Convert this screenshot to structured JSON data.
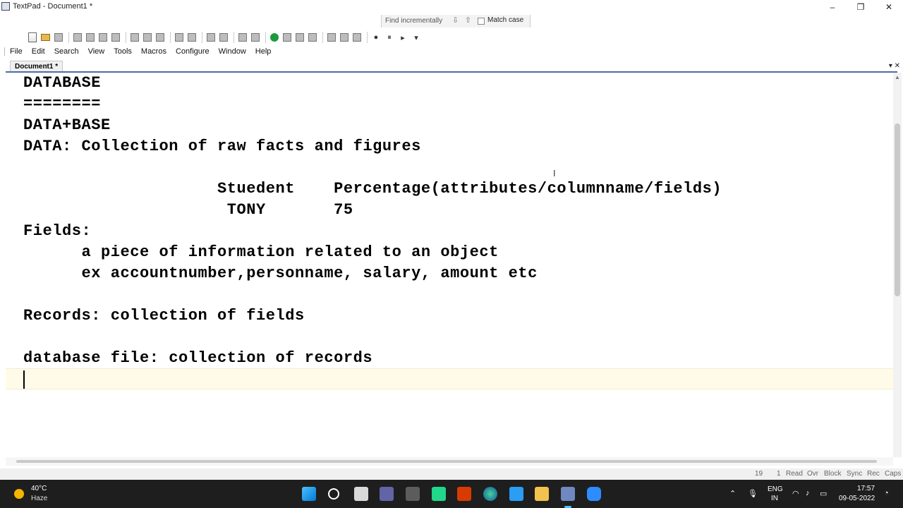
{
  "window": {
    "title": "TextPad - Document1 *",
    "minimize": "–",
    "maximize": "❐",
    "close": "✕"
  },
  "findbar": {
    "placeholder": "Find incrementally",
    "match_case_label": "Match case",
    "prev_arrow": "⇩",
    "next_arrow": "⇧"
  },
  "menu": [
    "File",
    "Edit",
    "Search",
    "View",
    "Tools",
    "Macros",
    "Configure",
    "Window",
    "Help"
  ],
  "tabs": [
    {
      "label": "Document1 *"
    }
  ],
  "tab_controls": "▾ ✕",
  "editor": {
    "lines": [
      "DATABASE",
      "========",
      "DATA+BASE",
      "DATA: Collection of raw facts and figures",
      "",
      "                    Stuedent    Percentage(attributes/columnname/fields)",
      "                     TONY       75",
      "Fields:",
      "      a piece of information related to an object",
      "      ex accountnumber,personname, salary, amount etc",
      "",
      "Records: collection of fields",
      "",
      "database file: collection of records",
      ""
    ],
    "cursor_line": 15
  },
  "status": {
    "line": "19",
    "col": "1",
    "read": "Read",
    "ovr": "Ovr",
    "block": "Block",
    "sync": "Sync",
    "rec": "Rec",
    "caps": "Caps"
  },
  "taskbar": {
    "weather_temp": "40°C",
    "weather_condition": "Haze",
    "apps": [
      "start-icon",
      "search-icon",
      "file-explorer-icon",
      "teams-icon",
      "camera-icon",
      "pycharm-icon",
      "office-icon",
      "edge-icon",
      "vscode-icon",
      "folder-icon",
      "textpad-icon",
      "zoom-icon"
    ],
    "lang_top": "ENG",
    "lang_bottom": "IN",
    "time": "17:57",
    "date": "09-05-2022"
  },
  "colors": {
    "current_line": "#fffbe8",
    "taskbar": "#1e1e1e",
    "editor_border": "#4a6ea9"
  }
}
